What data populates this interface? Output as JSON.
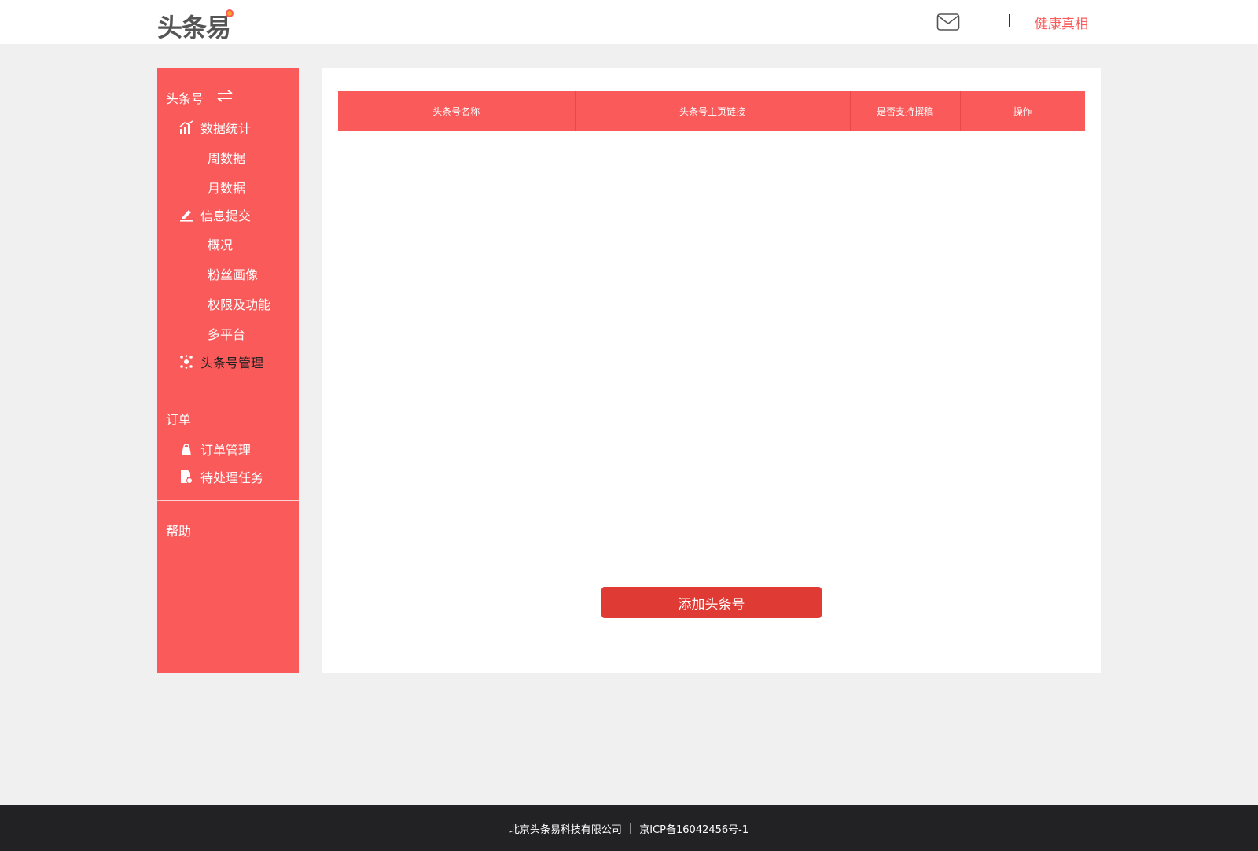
{
  "header": {
    "logo_text": "头条易",
    "user_name": "健康真相",
    "separator": "|",
    "icons": {
      "mail": "mail-icon"
    }
  },
  "sidebar": {
    "group_account": {
      "title": "头条号",
      "switch_icon": "swap-arrows-icon",
      "items": [
        {
          "label": "数据统计",
          "icon": "bar-chart-icon"
        },
        {
          "label": "周数据"
        },
        {
          "label": "月数据"
        },
        {
          "label": "信息提交",
          "icon": "edit-pen-icon"
        },
        {
          "label": "概况"
        },
        {
          "label": "粉丝画像"
        },
        {
          "label": "权限及功能"
        },
        {
          "label": "多平台"
        },
        {
          "label": "头条号管理",
          "icon": "network-icon",
          "active": true
        }
      ]
    },
    "group_order": {
      "title": "订单",
      "items": [
        {
          "label": "订单管理",
          "icon": "order-bag-icon"
        },
        {
          "label": "待处理任务",
          "icon": "task-doc-icon"
        }
      ]
    },
    "group_help": {
      "title": "帮助"
    }
  },
  "main": {
    "table_headers": [
      "头条号名称",
      "头条号主页链接",
      "是否支持撰稿",
      "操作"
    ],
    "rows": [],
    "add_button": "添加头条号"
  },
  "footer": {
    "company": "北京头条易科技有限公司",
    "separator": "|",
    "icp": "京ICP备16042456号-1"
  },
  "colors": {
    "accent": "#fa5a5a",
    "button": "#e03a34",
    "footer_bg": "#222224",
    "page_bg": "#f0f0f0"
  }
}
